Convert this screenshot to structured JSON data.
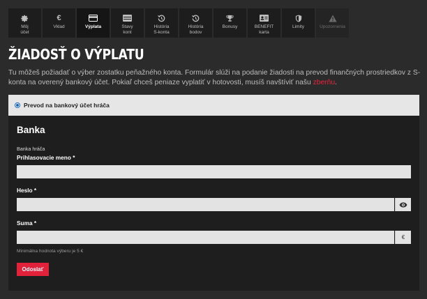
{
  "tabs": [
    {
      "label": "Môj\núčet",
      "icon": "gear-icon",
      "glyph": "⚙",
      "state": "normal"
    },
    {
      "label": "Vklad",
      "icon": "euro-icon",
      "glyph": "€",
      "state": "normal"
    },
    {
      "label": "Výplata",
      "icon": "card-icon",
      "glyph": "",
      "state": "active"
    },
    {
      "label": "Stavy\nkont",
      "icon": "wallet-icon",
      "glyph": "",
      "state": "normal"
    },
    {
      "label": "História\nS-konta",
      "icon": "history-icon",
      "glyph": "",
      "state": "normal"
    },
    {
      "label": "História\nbodov",
      "icon": "history-icon",
      "glyph": "",
      "state": "normal"
    },
    {
      "label": "Bonusy",
      "icon": "trophy-icon",
      "glyph": "",
      "state": "normal"
    },
    {
      "label": "BENEFIT\nkarta",
      "icon": "id-card-icon",
      "glyph": "",
      "state": "normal"
    },
    {
      "label": "Limity",
      "icon": "shield-icon",
      "glyph": "",
      "state": "normal"
    },
    {
      "label": "Upozornenia",
      "icon": "warning-icon",
      "glyph": "",
      "state": "disabled"
    }
  ],
  "page": {
    "title": "ŽIADOSŤ O VÝPLATU",
    "intro_text": "Tu môžeš požiadať o výber zostatku peňažného konta. Formulár slúži na podanie žiadosti na prevod finančných prostriedkov z S-konta na overený bankový účet. Pokiaľ chceš peniaze vyplatiť v hotovosti, musíš navštíviť našu ",
    "intro_link": "zberňu",
    "intro_end": "."
  },
  "payout_option": {
    "label": "Prevod na bankový účet hráča",
    "selected": true
  },
  "form": {
    "section_title": "Banka",
    "bank_player_label": "Banka hráča",
    "username_label": "Prihlasovacie meno *",
    "username_value": "",
    "password_label": "Heslo *",
    "password_value": "",
    "password_toggle_icon": "eye-icon",
    "amount_label": "Suma *",
    "amount_value": "",
    "currency_symbol": "€",
    "min_hint": "Minimálna hodnota výberu je 5 €",
    "submit_label": "Odoslať"
  },
  "colors": {
    "accent": "#e2213b",
    "radio": "#1565c0",
    "background": "#2b2b2b",
    "card": "#1e1e1e"
  }
}
